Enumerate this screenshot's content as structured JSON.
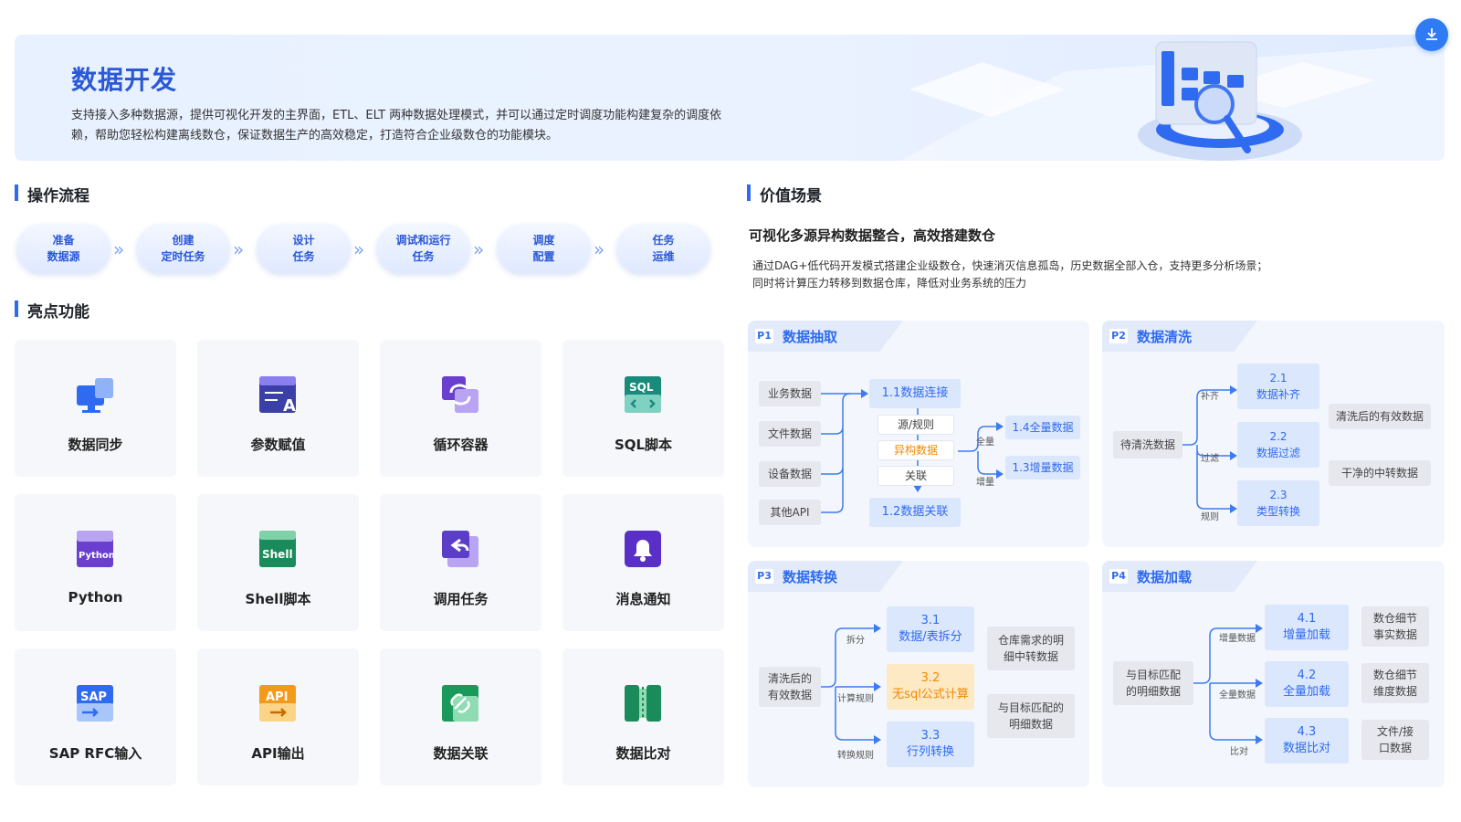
{
  "banner": {
    "title": "数据开发",
    "desc": "支持接入多种数据源，提供可视化开发的主界面，ETL、ELT 两种数据处理模式，并可以通过定时调度功能构建复杂的调度依赖，帮助您轻松构建离线数仓，保证数据生产的高效稳定，打造符合企业级数仓的功能模块。"
  },
  "sections": {
    "flow": "操作流程",
    "features": "亮点功能",
    "value": "价值场景"
  },
  "flow_steps": [
    "准备\n数据源",
    "创建\n定时任务",
    "设计\n任务",
    "调试和运行\n任务",
    "调度\n配置",
    "任务\n运维"
  ],
  "features": [
    {
      "label": "数据同步",
      "icon": "data-sync-icon"
    },
    {
      "label": "参数赋值",
      "icon": "param-assign-icon"
    },
    {
      "label": "循环容器",
      "icon": "loop-container-icon"
    },
    {
      "label": "SQL脚本",
      "icon": "sql-script-icon",
      "tag": "SQL"
    },
    {
      "label": "Python",
      "icon": "python-icon",
      "tag": "Python"
    },
    {
      "label": "Shell脚本",
      "icon": "shell-script-icon",
      "tag": "Shell"
    },
    {
      "label": "调用任务",
      "icon": "call-task-icon"
    },
    {
      "label": "消息通知",
      "icon": "notification-bell-icon"
    },
    {
      "label": "SAP RFC输入",
      "icon": "sap-rfc-icon",
      "tag": "SAP"
    },
    {
      "label": "API输出",
      "icon": "api-output-icon",
      "tag": "API"
    },
    {
      "label": "数据关联",
      "icon": "data-link-icon"
    },
    {
      "label": "数据比对",
      "icon": "data-compare-icon"
    }
  ],
  "value": {
    "subtitle": "可视化多源异构数据整合，高效搭建数仓",
    "desc1": "通过DAG+低代码开发模式搭建企业级数仓，快速消灭信息孤岛，历史数据全部入仓，支持更多分析场景；",
    "desc2": "同时将计算压力转移到数据仓库，降低对业务系统的压力"
  },
  "p1": {
    "badge": "P1",
    "title": "数据抽取",
    "sources": [
      "业务数据",
      "文件数据",
      "设备数据",
      "其他API"
    ],
    "conn": "1.1数据连接",
    "rule": "源/规则",
    "hetero": "异构数据",
    "rel": "关联",
    "join": "1.2数据关联",
    "full_lbl": "全量",
    "inc_lbl": "增量",
    "full": "1.4全量数据",
    "inc": "1.3增量数据"
  },
  "p2": {
    "badge": "P2",
    "title": "数据清洗",
    "src": "待清洗数据",
    "lbls": [
      "补齐",
      "过滤",
      "规则"
    ],
    "steps": [
      "2.1\n数据补齐",
      "2.2\n数据过滤",
      "2.3\n类型转换"
    ],
    "outs": [
      "清洗后的有效数据",
      "干净的中转数据"
    ]
  },
  "p3": {
    "badge": "P3",
    "title": "数据转换",
    "src": "清洗后的\n有效数据",
    "lbls": [
      "拆分",
      "计算规则",
      "转换规则"
    ],
    "steps": [
      "3.1\n数据/表拆分",
      "3.2\n无sql公式计算",
      "3.3\n行列转换"
    ],
    "outs": [
      "仓库需求的明\n细中转数据",
      "与目标匹配的\n明细数据"
    ]
  },
  "p4": {
    "badge": "P4",
    "title": "数据加载",
    "src": "与目标匹配\n的明细数据",
    "lbls": [
      "增量数据",
      "全量数据",
      "比对"
    ],
    "steps": [
      "4.1\n增量加载",
      "4.2\n全量加载",
      "4.3\n数据比对"
    ],
    "outs": [
      "数仓细节\n事实数据",
      "数仓细节\n维度数据",
      "文件/接\n口数据"
    ]
  }
}
